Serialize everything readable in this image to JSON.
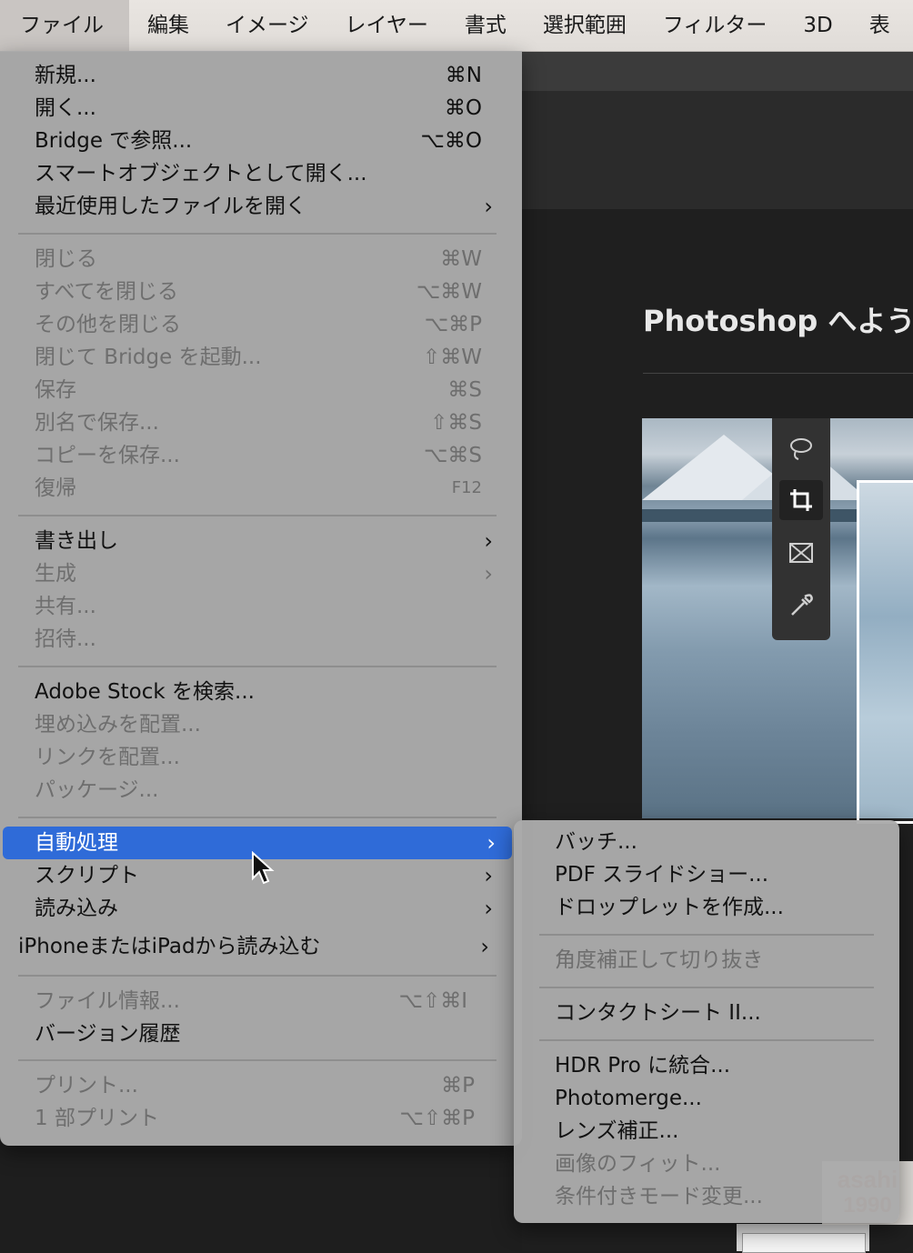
{
  "menubar": {
    "items": [
      "ファイル",
      "編集",
      "イメージ",
      "レイヤー",
      "書式",
      "選択範囲",
      "フィルター",
      "3D",
      "表"
    ]
  },
  "welcome_title": "Photoshop へようこ",
  "file_menu": {
    "g1": [
      {
        "label": "新規...",
        "shortcut": "⌘N"
      },
      {
        "label": "開く...",
        "shortcut": "⌘O"
      },
      {
        "label": "Bridge で参照...",
        "shortcut": "⌥⌘O"
      },
      {
        "label": "スマートオブジェクトとして開く..."
      },
      {
        "label": "最近使用したファイルを開く",
        "arrow": "›"
      }
    ],
    "g2": [
      {
        "label": "閉じる",
        "shortcut": "⌘W"
      },
      {
        "label": "すべてを閉じる",
        "shortcut": "⌥⌘W"
      },
      {
        "label": "その他を閉じる",
        "shortcut": "⌥⌘P"
      },
      {
        "label": "閉じて Bridge を起動...",
        "shortcut": "⇧⌘W"
      },
      {
        "label": "保存",
        "shortcut": "⌘S"
      },
      {
        "label": "別名で保存...",
        "shortcut": "⇧⌘S"
      },
      {
        "label": "コピーを保存...",
        "shortcut": "⌥⌘S"
      },
      {
        "label": "復帰",
        "shortcut": "F12"
      }
    ],
    "g3": [
      {
        "label": "書き出し",
        "arrow": "›"
      },
      {
        "label": "生成",
        "arrow": "›"
      },
      {
        "label": "共有..."
      },
      {
        "label": "招待..."
      }
    ],
    "g4": [
      {
        "label": "Adobe Stock を検索..."
      },
      {
        "label": "埋め込みを配置..."
      },
      {
        "label": "リンクを配置..."
      },
      {
        "label": "パッケージ..."
      }
    ],
    "g5": [
      {
        "label": "自動処理",
        "arrow": "›"
      },
      {
        "label": "スクリプト",
        "arrow": "›"
      },
      {
        "label": "読み込み",
        "arrow": "›"
      },
      {
        "label": "iPhoneまたはiPadから読み込む",
        "arrow": "›"
      }
    ],
    "g6": [
      {
        "label": "ファイル情報...",
        "shortcut": "⌥⇧⌘I"
      },
      {
        "label": "バージョン履歴"
      }
    ],
    "g7": [
      {
        "label": "プリント...",
        "shortcut": "⌘P"
      },
      {
        "label": "1 部プリント",
        "shortcut": "⌥⇧⌘P"
      }
    ]
  },
  "automate_submenu": {
    "g1": [
      "バッチ...",
      "PDF スライドショー...",
      "ドロップレットを作成..."
    ],
    "g2": [
      "角度補正して切り抜き"
    ],
    "g3": [
      "コンタクトシート II..."
    ],
    "g4": [
      "HDR Pro に統合...",
      "Photomerge...",
      "レンズ補正...",
      "画像のフィット...",
      "条件付きモード変更..."
    ]
  },
  "watermark": {
    "line1": "asahi",
    "line2": "1990"
  },
  "colors": {
    "highlight": "#2f6bd8",
    "menu_bg": "#aaaaaa",
    "disabled_text": "#6e6e6e"
  }
}
